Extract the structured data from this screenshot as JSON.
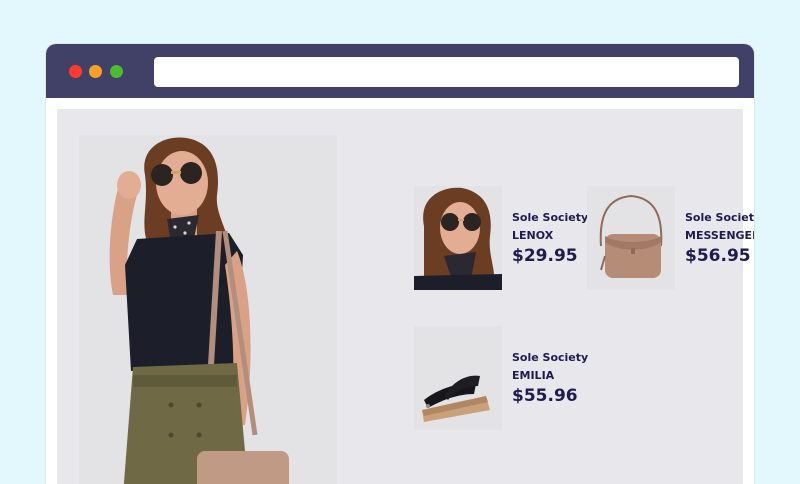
{
  "browser": {
    "title_bar_color": "#414168",
    "window_controls": [
      "close",
      "minimize",
      "maximize"
    ],
    "url": ""
  },
  "hero": {
    "image": "model-wearing-sunglasses-scarf-and-crossbody-bag"
  },
  "products": [
    {
      "brand": "Sole Society",
      "name": "LENOX",
      "price": "$29.95",
      "image": "sunglasses-model-thumbnail"
    },
    {
      "brand": "Sole Society",
      "name": "MESSENGER",
      "price": "$56.95",
      "image": "tan-crossbody-bag-thumbnail"
    },
    {
      "brand": "Sole Society",
      "name": "EMILIA",
      "price": "$55.96",
      "image": "black-wedge-sandal-thumbnail"
    }
  ],
  "colors": {
    "background": "#e3f8fd",
    "text": "#1e1b4f",
    "panel": "#e8e7ec"
  }
}
